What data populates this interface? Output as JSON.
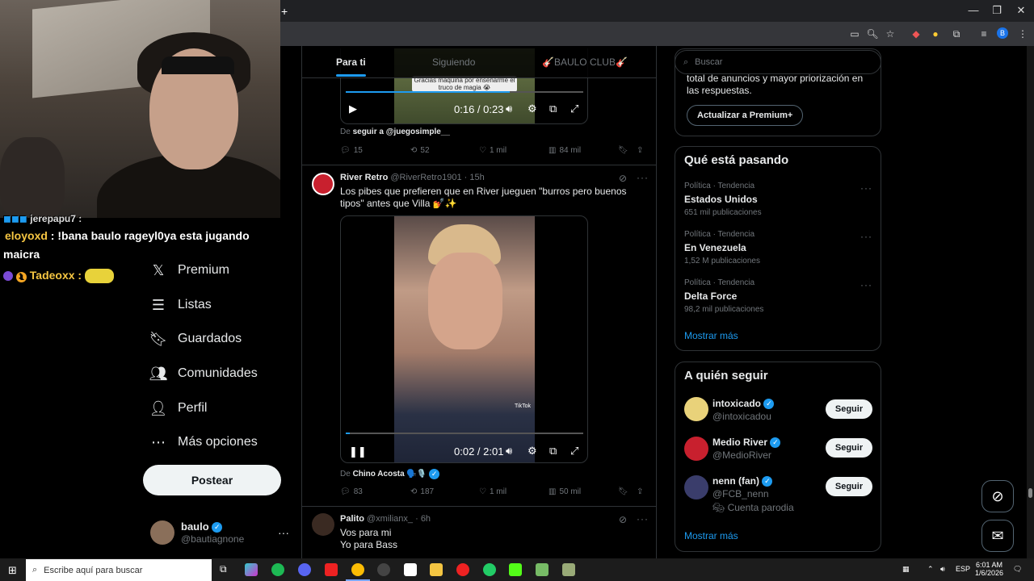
{
  "browser": {
    "new_tab": "+",
    "window_controls": [
      "—",
      "❐",
      "✕"
    ],
    "profile_initial": "B"
  },
  "chat": {
    "line0": "jerepapu7 :",
    "line1_user": "eloyoxd",
    "line1_msg": ": !bana baulo rageyl0ya esta jugando",
    "line2": "maicra",
    "line3_user": "Tadeoxx :",
    "badge": "1"
  },
  "sidebar": {
    "items": [
      {
        "label": "Premium",
        "icon": "x-logo-icon"
      },
      {
        "label": "Listas",
        "icon": "list-icon"
      },
      {
        "label": "Guardados",
        "icon": "bookmark-icon"
      },
      {
        "label": "Comunidades",
        "icon": "communities-icon"
      },
      {
        "label": "Perfil",
        "icon": "person-icon"
      },
      {
        "label": "Más opciones",
        "icon": "more-circle-icon"
      }
    ],
    "post_label": "Postear",
    "account": {
      "name": "baulo",
      "handle": "@bautiagnone",
      "more": "···"
    }
  },
  "tabs": {
    "for_you": "Para ti",
    "following": "Siguiendo",
    "club": "🎸BAULO CLUB🎸"
  },
  "tweet1": {
    "caption": "Gracias maquina por enseñarme el truco de magia 😭",
    "time": "0:16 / 0:23",
    "from_prefix": "De",
    "from": "seguir a @juegosimple__",
    "replies": "15",
    "retweets": "52",
    "likes": "1 mil",
    "views": "84 mil"
  },
  "tweet2": {
    "name": "River Retro",
    "handle": "@RiverRetro1901",
    "age": "· 15h",
    "text": "Los pibes que prefieren que en River jueguen \"burros pero buenos tipos\" antes que Villa 💅✨",
    "time": "0:02 / 2:01",
    "watermark": "TikTok",
    "from_prefix": "De",
    "from": "Chino Acosta 🗣️🎙️",
    "replies": "83",
    "retweets": "187",
    "likes": "1 mil",
    "views": "50 mil",
    "progress": 0.017
  },
  "tweet3": {
    "name": "Palito",
    "handle": "@xmilianx_",
    "age": "· 6h",
    "line1": "Vos para mi",
    "line2": "Yo para Bass"
  },
  "right": {
    "search_placeholder": "Buscar",
    "premium_text": "total de anuncios y mayor priorización en las respuestas.",
    "premium_button": "Actualizar a Premium+",
    "trends_title": "Qué está pasando",
    "trends": [
      {
        "meta": "Política · Tendencia",
        "name": "Estados Unidos",
        "count": "651 mil publicaciones"
      },
      {
        "meta": "Política · Tendencia",
        "name": "En Venezuela",
        "count": "1,52 M publicaciones"
      },
      {
        "meta": "Política · Tendencia",
        "name": "Delta Force",
        "count": "98,2 mil publicaciones"
      }
    ],
    "show_more": "Mostrar más",
    "follow_title": "A quién seguir",
    "follow": [
      {
        "name": "intoxicado",
        "handle": "@intoxicadou",
        "button": "Seguir",
        "extra": ""
      },
      {
        "name": "Medio River",
        "handle": "@MedioRiver",
        "button": "Seguir",
        "extra": ""
      },
      {
        "name": "nenn (fan)",
        "handle": "@FCB_nenn",
        "button": "Seguir",
        "extra": "Cuenta parodia"
      }
    ],
    "show_more2": "Mostrar más"
  },
  "taskbar": {
    "search_placeholder": "Escribe aquí para buscar",
    "lang": "ESP",
    "time": "6:01 AM",
    "date": "1/6/2026"
  },
  "colors": {
    "accent": "#1d9bf0",
    "bg": "#000000",
    "border": "#2f3336",
    "muted": "#71767b"
  }
}
